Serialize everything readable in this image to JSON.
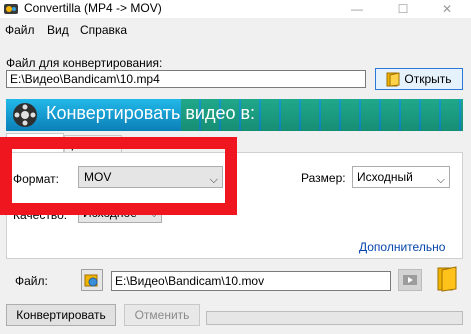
{
  "window": {
    "title": "Convertilla  (MP4 -> MOV)",
    "minimize_glyph": "—",
    "maximize_glyph": "☐",
    "close_glyph": "✕"
  },
  "menu": {
    "items": [
      "Файл",
      "Вид",
      "Справка"
    ]
  },
  "source": {
    "label": "Файл для конвертирования:",
    "value": "E:\\Видео\\Bandicam\\10.mp4",
    "open_label": "Открыть"
  },
  "banner": {
    "text": "Конвертировать видео в:"
  },
  "tabs": {
    "second_partial": "р"
  },
  "settings": {
    "format_label": "Формат:",
    "format_value": "MOV",
    "size_label": "Размер:",
    "size_value": "Исходный",
    "quality_label": "Качество:",
    "quality_value": "Исходное",
    "advanced_link": "Дополнительно"
  },
  "output": {
    "label": "Файл:",
    "value": "E:\\Видео\\Bandicam\\10.mov"
  },
  "actions": {
    "convert_label": "Конвертировать",
    "cancel_label": "Отменить"
  },
  "progress": {
    "fraction": 0
  },
  "colors": {
    "accent": "#2b78d8",
    "banner": "#0b7fb8",
    "highlight": "#ef1620",
    "link": "#0645ad"
  },
  "icons": [
    "app-icon",
    "folder-open-icon",
    "film-reel-icon",
    "chevron-down-icon",
    "output-folder-icon",
    "play-icon",
    "folder-icon"
  ]
}
